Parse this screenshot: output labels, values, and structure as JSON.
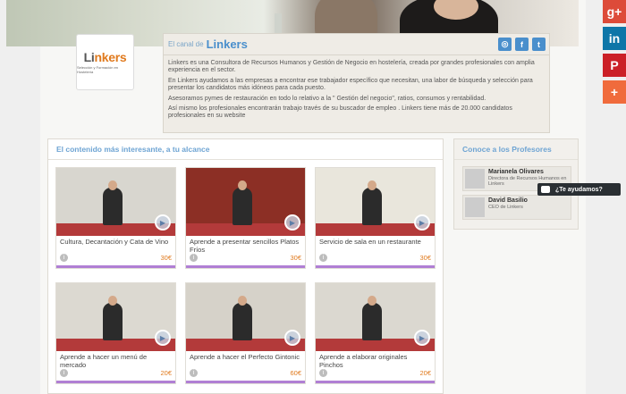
{
  "social": [
    {
      "name": "google-plus-icon",
      "glyph": "g+",
      "color": "#dd4b39"
    },
    {
      "name": "linkedin-icon",
      "glyph": "in",
      "color": "#0e76a8"
    },
    {
      "name": "pinterest-icon",
      "glyph": "P",
      "color": "#cb2027"
    },
    {
      "name": "plus-icon",
      "glyph": "+",
      "color": "#f06b3c"
    }
  ],
  "logo": {
    "word_a": "Li",
    "word_b": "nkers",
    "subtitle": "Selección y Formación en Hostelería"
  },
  "canal": {
    "prefix": "El canal de",
    "brand": "Linkers",
    "paragraphs": [
      "Linkers es una Consultora de Recursos Humanos y Gestión de Negocio en hostelería, creada por grandes profesionales con amplia experiencia en el sector.",
      "En Linkers ayudamos a las empresas a encontrar ese trabajador específico que necesitan, una labor de búsqueda y selección para presentar  los candidatos más idóneos para cada puesto.",
      "Asesoramos pymes de restauración en todo lo relativo a la \" Gestión del negocio\", ratios, consumos y rentabilidad.",
      "Así mismo los profesionales encontrarán trabajo través de su buscador de empleo . Linkers tiene más de 20.000 candidatos profesionales en su website"
    ]
  },
  "main": {
    "title": "El contenido más interesante, a tu alcance",
    "cards": [
      {
        "title": "Cultura, Decantación y Cata de Vino",
        "price": "30€",
        "wall": "#d8d6cf"
      },
      {
        "title": "Aprende a presentar sencillos Platos Fríos",
        "price": "30€",
        "wall": "#8c2f25"
      },
      {
        "title": "Servicio de sala en un restaurante",
        "price": "30€",
        "wall": "#e9e6dc"
      },
      {
        "title": "Aprende a hacer un menú de mercado",
        "price": "20€",
        "wall": "#dcd9d1"
      },
      {
        "title": "Aprende a hacer el Perfecto Gintonic",
        "price": "60€",
        "wall": "#d6d2c9"
      },
      {
        "title": "Aprende a elaborar originales Pinchos",
        "price": "20€",
        "wall": "#dbd8d0"
      }
    ]
  },
  "side": {
    "title": "Conoce a los Profesores",
    "profs": [
      {
        "name": "Marianela Olivares",
        "role": "Directora de Recursos Humanos en Linkers"
      },
      {
        "name": "David Basilio",
        "role": "CEO de Linkers"
      }
    ]
  },
  "help": {
    "label": "¿Te ayudamos?"
  },
  "colors": {
    "accent": "#4a8fcc",
    "price": "#e07a1e",
    "card_bar": "#b07fd4"
  }
}
